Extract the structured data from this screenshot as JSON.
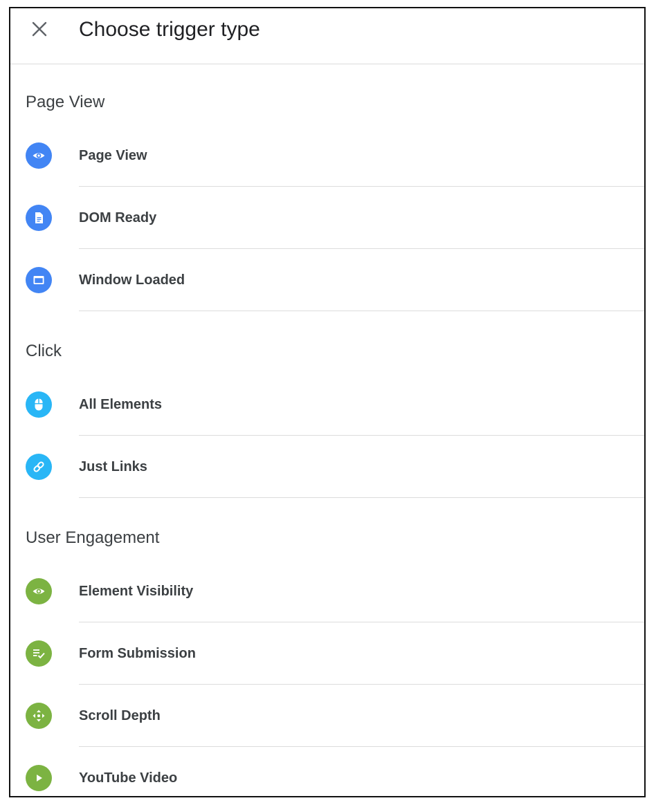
{
  "header": {
    "title": "Choose trigger type",
    "close_icon": "close-icon"
  },
  "colors": {
    "page_view": "#4285f4",
    "click": "#29b6f6",
    "engagement": "#7cb342",
    "text": "#3c4043"
  },
  "sections": [
    {
      "title": "Page View",
      "items": [
        {
          "label": "Page View",
          "icon": "eye-icon"
        },
        {
          "label": "DOM Ready",
          "icon": "document-icon"
        },
        {
          "label": "Window Loaded",
          "icon": "window-icon"
        }
      ]
    },
    {
      "title": "Click",
      "items": [
        {
          "label": "All Elements",
          "icon": "mouse-icon"
        },
        {
          "label": "Just Links",
          "icon": "link-icon"
        }
      ]
    },
    {
      "title": "User Engagement",
      "items": [
        {
          "label": "Element Visibility",
          "icon": "eye-icon"
        },
        {
          "label": "Form Submission",
          "icon": "form-check-icon"
        },
        {
          "label": "Scroll Depth",
          "icon": "scroll-arrows-icon"
        },
        {
          "label": "YouTube Video",
          "icon": "play-icon"
        }
      ]
    }
  ]
}
